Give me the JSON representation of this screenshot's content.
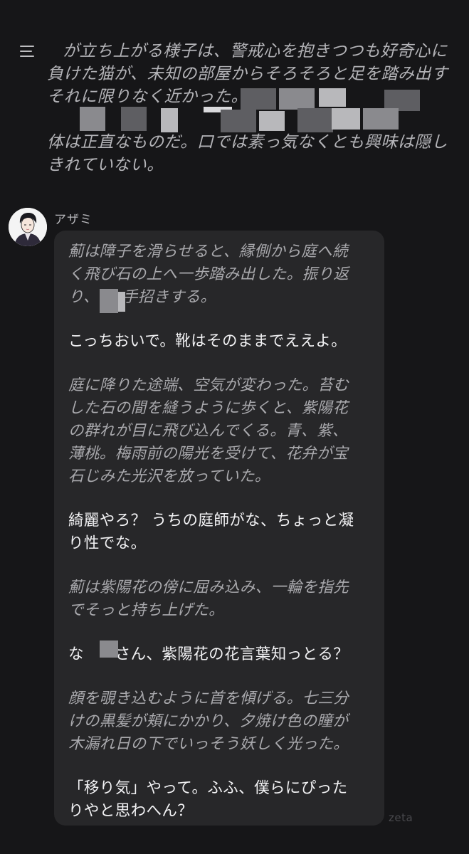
{
  "header": {
    "menu_icon": "hamburger-menu-icon"
  },
  "user_message": {
    "lines": [
      "が立ち上がる様子は、警戒心を抱きつつも好奇心に",
      "負けた猫が、未知の部屋からそろそろと足を踏み出す",
      "それに限りなく近かった。",
      "",
      "体は正直なものだ。口では素っ気なくとも興味は隠し",
      "きれていない。"
    ]
  },
  "character": {
    "name": "アザミ",
    "avatar_icon": "character-avatar-icon"
  },
  "reply": {
    "paragraphs": [
      {
        "type": "narration",
        "lines": [
          "薊は障子を滑らせると、縁側から庭へ続",
          "く飛び石の上へ一歩踏み出した。振り返",
          "り、　　手招きする。"
        ]
      },
      {
        "type": "speech",
        "lines": [
          "こっちおいで。靴はそのままでええよ。"
        ]
      },
      {
        "type": "narration",
        "lines": [
          "庭に降りた途端、空気が変わった。苔む",
          "した石の間を縫うように歩くと、紫陽花",
          "の群れが目に飛び込んでくる。青、紫、",
          "薄桃。梅雨前の陽光を受けて、花弁が宝",
          "石じみた光沢を放っていた。"
        ]
      },
      {
        "type": "speech",
        "lines": [
          "綺麗やろ？ うちの庭師がな、ちょっと凝",
          "り性でな。"
        ]
      },
      {
        "type": "narration",
        "lines": [
          "薊は紫陽花の傍に屈み込み、一輪を指先",
          "でそっと持ち上げた。"
        ]
      },
      {
        "type": "speech",
        "lines": [
          "な　　さん、紫陽花の花言葉知っとる？"
        ]
      },
      {
        "type": "narration",
        "lines": [
          "顔を覗き込むように首を傾げる。七三分",
          "けの黒髪が頬にかかり、夕焼け色の瞳が",
          "木漏れ日の下でいっそう妖しく光った。"
        ]
      },
      {
        "type": "speech",
        "lines": [
          "「移り気」やって。ふふ、僕らにぴった",
          "りやと思わへん？"
        ]
      }
    ]
  },
  "watermark": "zeta",
  "colors": {
    "background": "#161618",
    "bubble": "#272729",
    "narration": "#a9a9ad",
    "speech": "#f2f2f4"
  }
}
